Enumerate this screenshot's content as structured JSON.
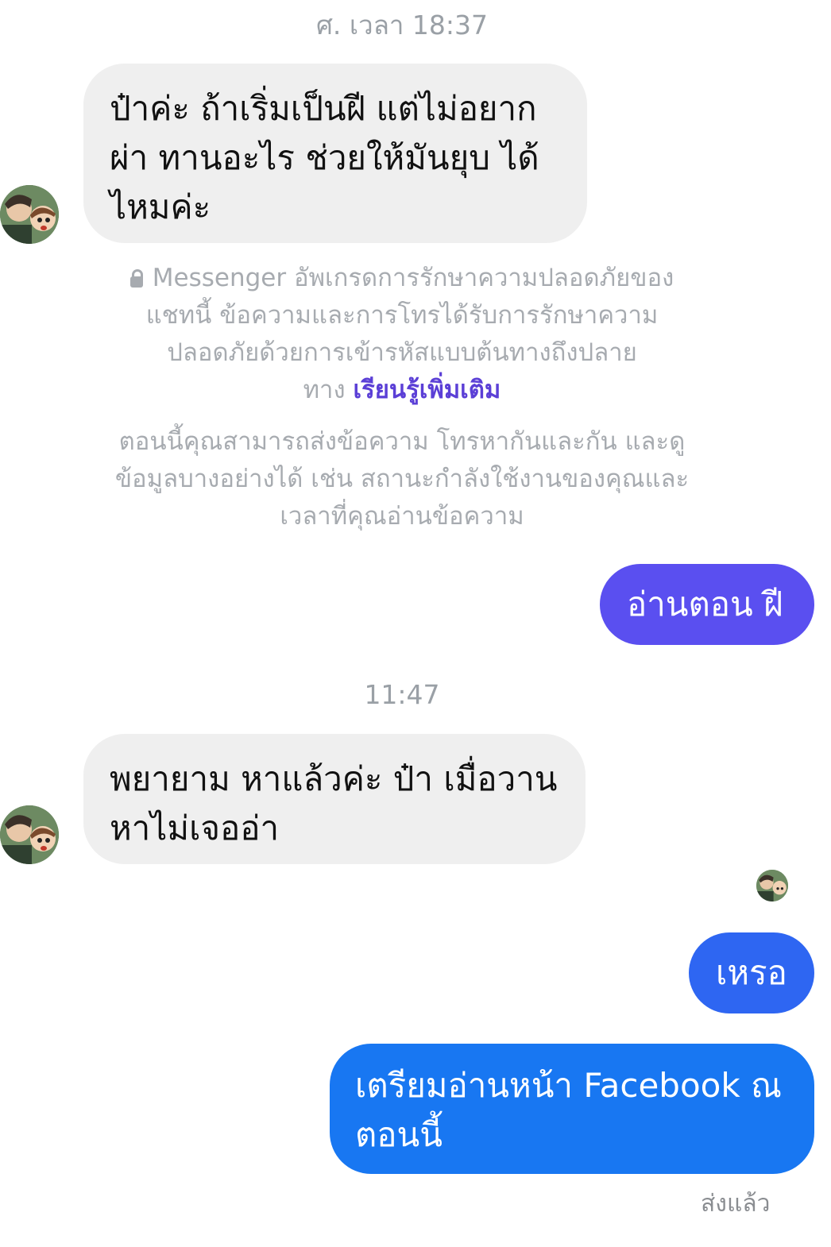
{
  "conversation": {
    "timestamp_1": "ศ. เวลา 18:37",
    "timestamp_2": "11:47",
    "messages": [
      {
        "text": "ป๋าค่ะ ถ้าเริ่มเป็นฝี แต่ไม่อยาก\nผ่า ทานอะไร ช่วยให้มันยุบ ได้\nไหมค่ะ"
      },
      {
        "text": "อ่านตอน ฝี"
      },
      {
        "text": "พยายาม หาแล้วค่ะ ป๋า เมื่อวาน\nหาไม่เจออ่า"
      },
      {
        "text": "เหรอ"
      },
      {
        "text": "เตรียมอ่านหน้า Facebook ณ\nตอนนี้"
      }
    ],
    "encryption_notice": "Messenger อัพเกรดการรักษาความปลอดภัยของ\nแชทนี้ ข้อความและการโทรได้รับการรักษาความ\nปลอดภัยด้วยการเข้ารหัสแบบต้นทางถึงปลาย\nทาง ",
    "learn_more": "เรียนรู้เพิ่มเติม",
    "connection_notice": "ตอนนี้คุณสามารถส่งข้อความ โทรหากันและกัน และดู\nข้อมูลบางอย่างได้ เช่น สถานะกำลังใช้งานของคุณและ\nเวลาที่คุณอ่านข้อความ",
    "sent_status": "ส่งแล้ว"
  },
  "colors": {
    "incoming_bubble": "#efefef",
    "outgoing_purple": "#5a4ff0",
    "outgoing_blue_1": "#2e66f2",
    "outgoing_blue_2": "#1877f2",
    "link": "#5b3fd6"
  },
  "icons": {
    "lock": "lock-icon",
    "avatar": "contact-avatar"
  }
}
